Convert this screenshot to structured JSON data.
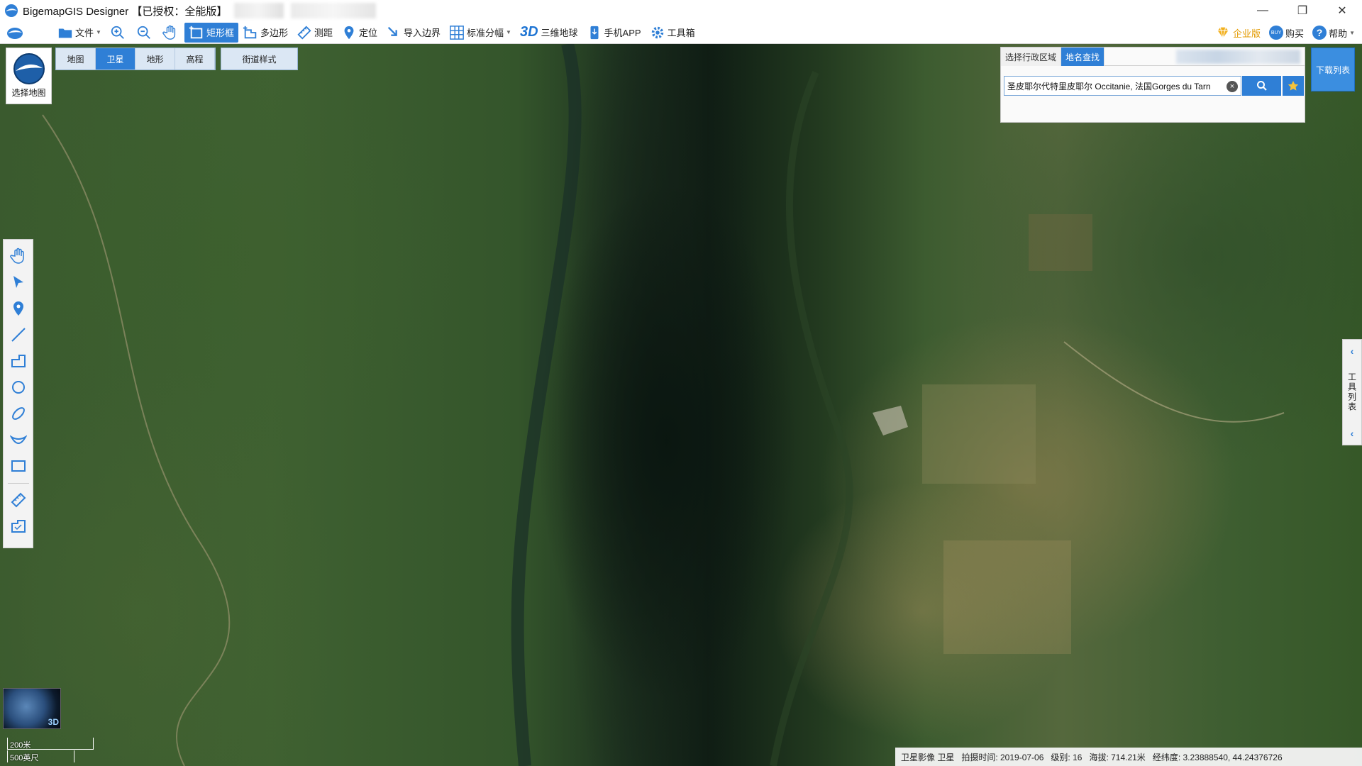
{
  "window": {
    "title": "BigemapGIS Designer 【已授权：全能版】",
    "controls": {
      "minimize": "—",
      "restore": "❐",
      "close": "✕"
    }
  },
  "toolbar": {
    "file": "文件",
    "rect_box": "矩形框",
    "polygon": "多边形",
    "measure": "测距",
    "locate": "定位",
    "import_boundary": "导入边界",
    "std_sheet": "标准分幅",
    "three_d_badge": "3D",
    "globe3d": "三维地球",
    "mobile_app": "手机APP",
    "toolbox": "工具箱",
    "enterprise": "企业版",
    "buy": "购买",
    "buy_badge": "BUY",
    "help": "帮助"
  },
  "map_selector": {
    "label": "选择地图"
  },
  "map_tabs": [
    {
      "label": "地图",
      "active": false
    },
    {
      "label": "卫星",
      "active": true
    },
    {
      "label": "地形",
      "active": false
    },
    {
      "label": "高程",
      "active": false
    }
  ],
  "street_style": "街道样式",
  "search_panel": {
    "tabs": [
      {
        "label": "选择行政区域",
        "active": false
      },
      {
        "label": "地名查找",
        "active": true
      }
    ],
    "query": "圣皮耶尔代特里皮耶尔 Occitanie, 法国Gorges du Tarn",
    "clear": "×"
  },
  "download_list": "下载列表",
  "tool_list": {
    "label": "工具列表"
  },
  "mini_globe": {
    "tag": "3D"
  },
  "scale": {
    "metric": "200米",
    "imperial": "500英尺"
  },
  "status": {
    "source": "卫星影像 卫星",
    "capture_time": "拍摄时间: 2019-07-06",
    "level": "级别:   16",
    "altitude": "海拔: 714.21米",
    "coords": "经纬度:   3.23888540, 44.24376726"
  },
  "colors": {
    "accent": "#2f7fd6",
    "toolbar_bg": "#ffffff",
    "status_bg": "#f5f5f5"
  }
}
